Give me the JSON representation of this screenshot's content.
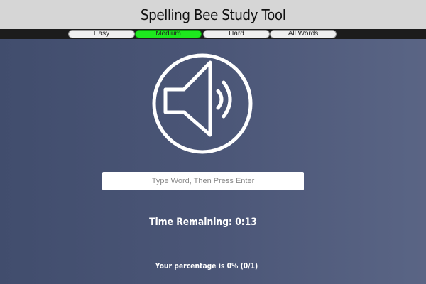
{
  "app": {
    "title": "Spelling Bee Study Tool"
  },
  "tabs": [
    {
      "label": "Easy",
      "active": false
    },
    {
      "label": "Medium",
      "active": true
    },
    {
      "label": "Hard",
      "active": false
    },
    {
      "label": "All Words",
      "active": false
    }
  ],
  "player": {
    "icon": "speaker-icon"
  },
  "word_input": {
    "placeholder": "Type Word, Then Press Enter",
    "value": ""
  },
  "status": {
    "time_remaining": "Time Remaining: 0:13",
    "percentage": "Your percentage is 0% (0/1)"
  },
  "colors": {
    "header_bg": "#d6d6d6",
    "tabbar_bg": "#1c1c1c",
    "active_tab": "#1ee81e",
    "page_bg": "#4b5677",
    "text": "#ffffff"
  }
}
